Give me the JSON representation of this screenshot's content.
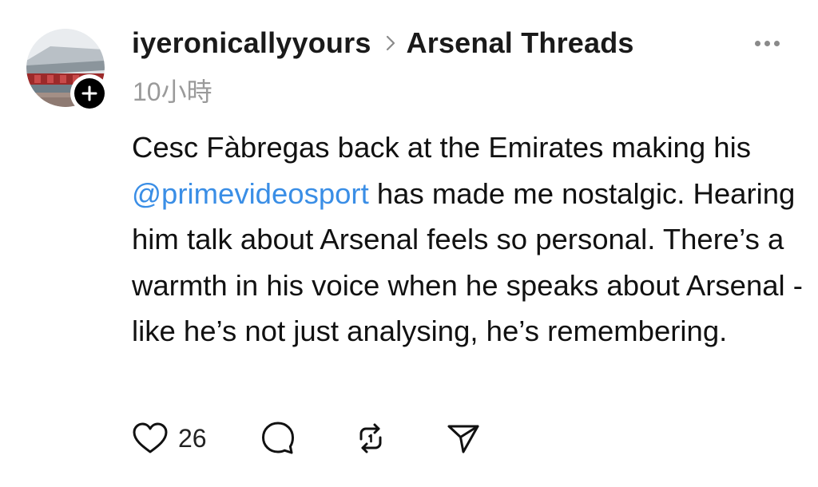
{
  "post": {
    "username": "iyeronicallyyours",
    "community": "Arsenal Threads",
    "timestamp": "10小時",
    "body": {
      "text_before": "Cesc Fàbregas back at the Emirates making his ",
      "mention": "@primevideosport",
      "text_after": " has made me nostalgic. Hearing him talk about Arsenal feels so personal. There’s a warmth in his voice when he speaks about Arsenal - like he’s not just analysing, he’s remembering."
    },
    "likes": "26"
  },
  "icons": {
    "avatar": "stadium-photo",
    "follow": "plus-icon",
    "separator": "chevron-right-icon",
    "more": "more-horizontal-icon",
    "like": "heart-icon",
    "comment": "comment-bubble-icon",
    "repost": "repost-icon",
    "share": "send-icon"
  },
  "colors": {
    "mention": "#3a8ee6",
    "timestamp": "#9a9a9a",
    "text": "#111111"
  }
}
